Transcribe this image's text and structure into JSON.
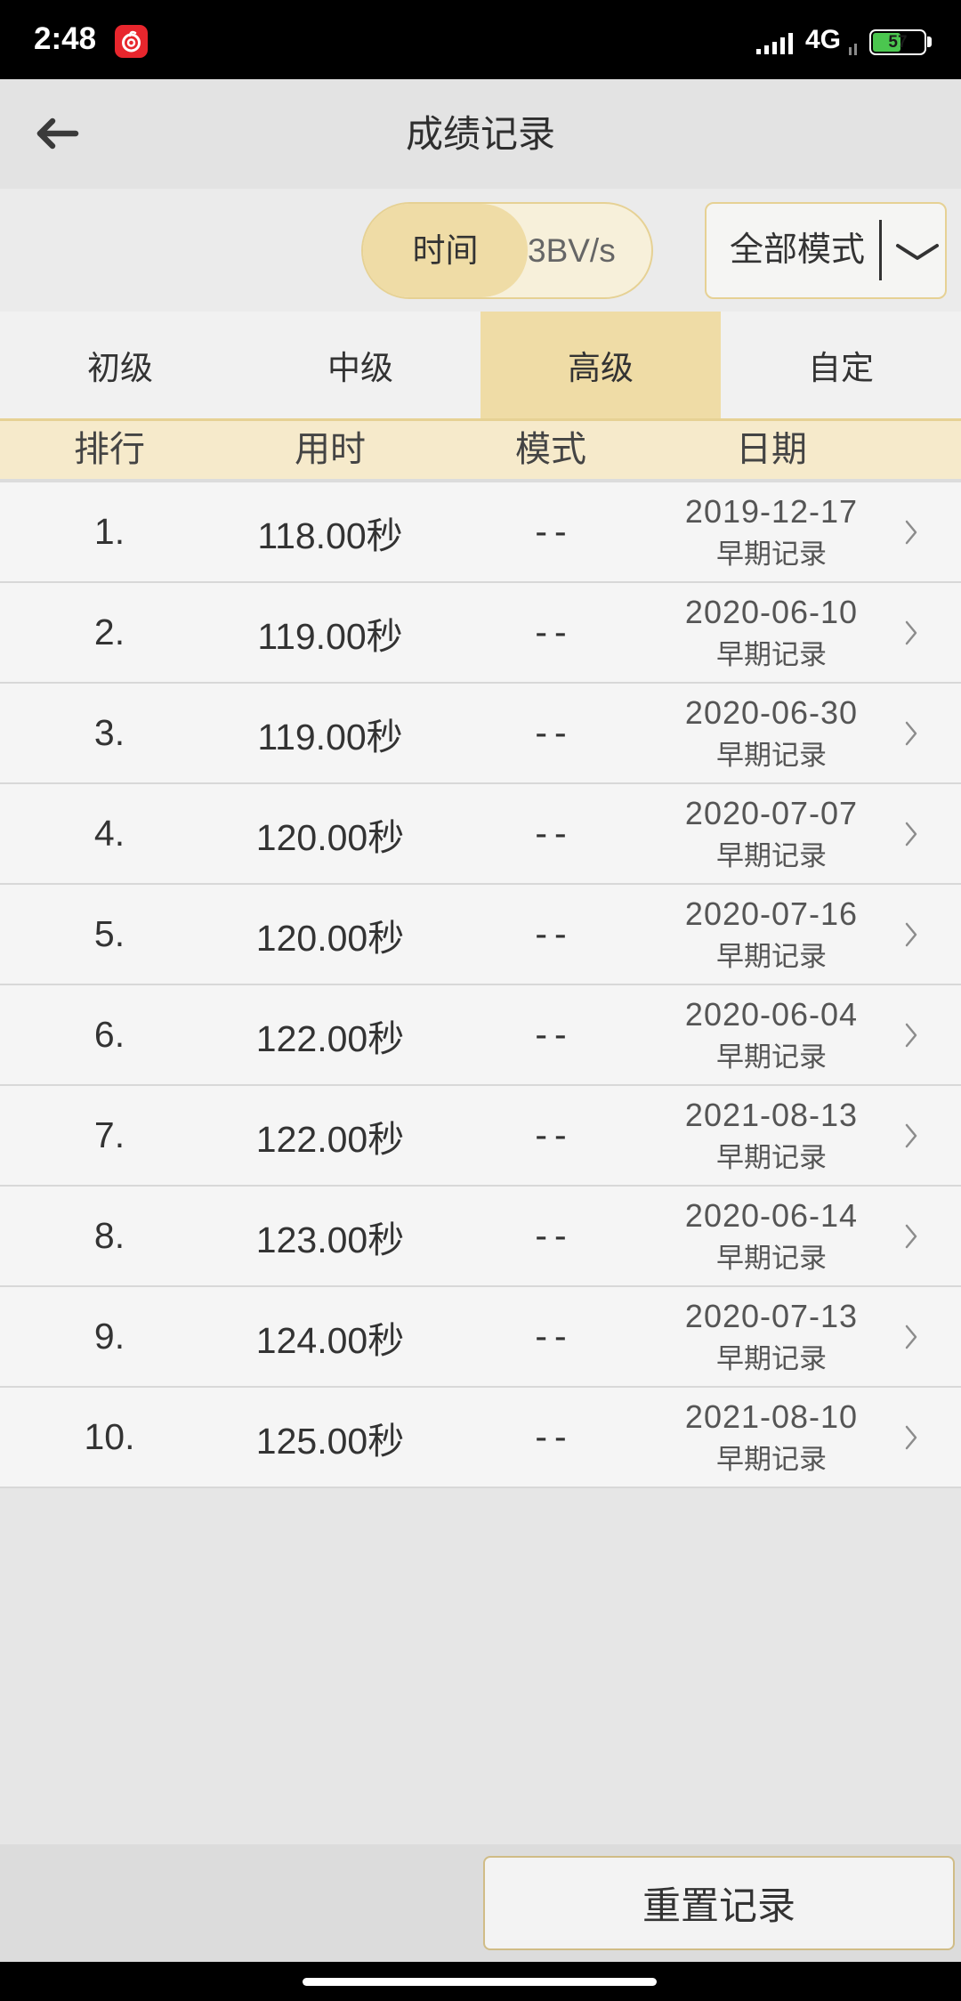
{
  "status_bar": {
    "time": "2:48",
    "app_icon": "netease-cloud-music-icon",
    "signal_icon": "signal-icon",
    "network": "4G",
    "battery": "57",
    "battery_icon": "battery-icon"
  },
  "header": {
    "back_icon": "arrow-left-icon",
    "title": "成绩记录"
  },
  "toolbar": {
    "sort_toggle": {
      "options": [
        "时间",
        "3BV/s"
      ],
      "selected_index": 0
    },
    "mode_select": {
      "value": "全部模式",
      "icon": "chevron-down-icon"
    }
  },
  "tabs": {
    "items": [
      {
        "label": "初级"
      },
      {
        "label": "中级"
      },
      {
        "label": "高级"
      },
      {
        "label": "自定"
      }
    ],
    "selected_index": 2
  },
  "table": {
    "columns": [
      "排行",
      "用时",
      "模式",
      "日期"
    ],
    "row_icon": "chevron-right-icon",
    "rows": [
      {
        "rank": "1.",
        "time": "118.00秒",
        "mode": "--",
        "date": "2019-12-17",
        "note": "早期记录"
      },
      {
        "rank": "2.",
        "time": "119.00秒",
        "mode": "--",
        "date": "2020-06-10",
        "note": "早期记录"
      },
      {
        "rank": "3.",
        "time": "119.00秒",
        "mode": "--",
        "date": "2020-06-30",
        "note": "早期记录"
      },
      {
        "rank": "4.",
        "time": "120.00秒",
        "mode": "--",
        "date": "2020-07-07",
        "note": "早期记录"
      },
      {
        "rank": "5.",
        "time": "120.00秒",
        "mode": "--",
        "date": "2020-07-16",
        "note": "早期记录"
      },
      {
        "rank": "6.",
        "time": "122.00秒",
        "mode": "--",
        "date": "2020-06-04",
        "note": "早期记录"
      },
      {
        "rank": "7.",
        "time": "122.00秒",
        "mode": "--",
        "date": "2021-08-13",
        "note": "早期记录"
      },
      {
        "rank": "8.",
        "time": "123.00秒",
        "mode": "--",
        "date": "2020-06-14",
        "note": "早期记录"
      },
      {
        "rank": "9.",
        "time": "124.00秒",
        "mode": "--",
        "date": "2020-07-13",
        "note": "早期记录"
      },
      {
        "rank": "10.",
        "time": "125.00秒",
        "mode": "--",
        "date": "2021-08-10",
        "note": "早期记录"
      }
    ]
  },
  "footer": {
    "reset_label": "重置记录"
  },
  "colors": {
    "accent": "#efdca6",
    "accent_light": "#f6eacb",
    "accent_border": "#e6d194",
    "battery": "#4bc64f"
  }
}
